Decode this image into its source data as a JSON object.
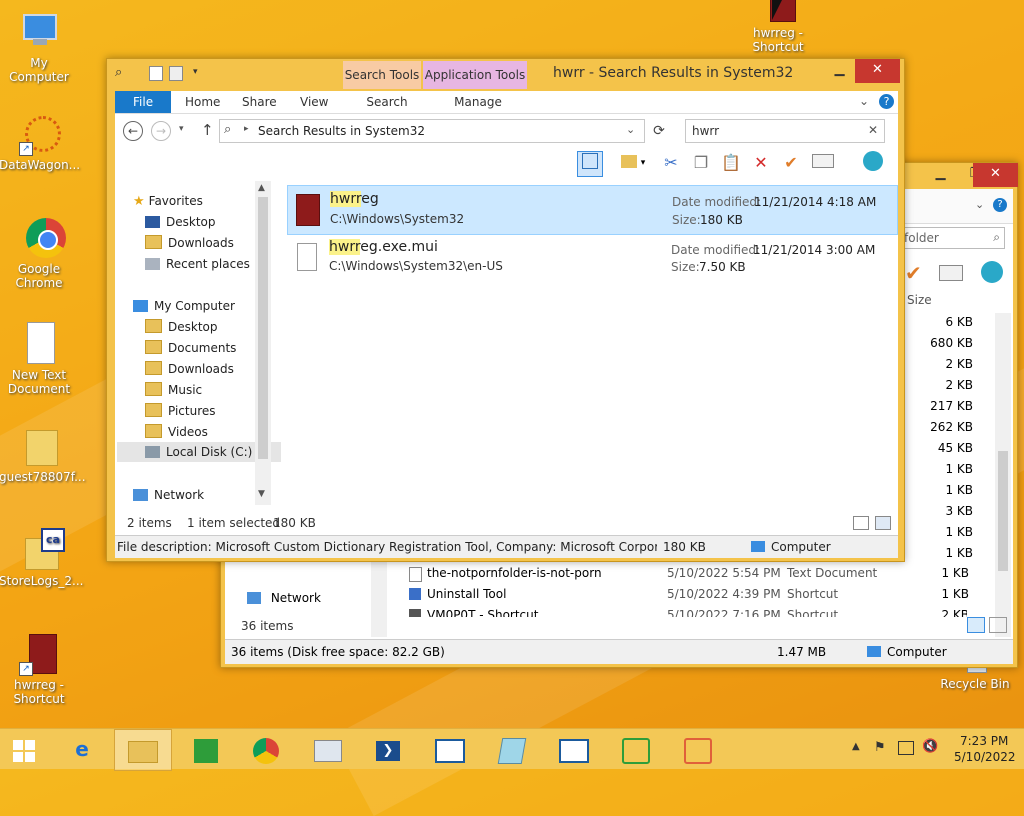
{
  "desktop": {
    "icons": [
      {
        "label": "My Computer"
      },
      {
        "label": "DataWagon..."
      },
      {
        "label": "Google Chrome"
      },
      {
        "label": "New Text Document"
      },
      {
        "label": "guest78807f..."
      },
      {
        "label": "StoreLogs_2..."
      },
      {
        "label": "hwrreg - Shortcut"
      },
      {
        "label": "hwrreg - Shortcut"
      },
      {
        "label": "Recycle Bin"
      }
    ]
  },
  "back_window": {
    "search_placeholder": "folder",
    "size_header": "Size",
    "sizes": [
      "6 KB",
      "680 KB",
      "2 KB",
      "2 KB",
      "217 KB",
      "262 KB",
      "45 KB",
      "1 KB",
      "1 KB",
      "3 KB",
      "1 KB",
      "1 KB"
    ],
    "rows": [
      {
        "name": "the-notpornfolder-is-not-porn",
        "date": "5/10/2022 5:54 PM",
        "type": "Text Document",
        "size": "1 KB"
      },
      {
        "name": "Uninstall Tool",
        "date": "5/10/2022 4:39 PM",
        "type": "Shortcut",
        "size": "1 KB"
      },
      {
        "name": "VM0P0T - Shortcut",
        "date": "5/10/2022 7:16 PM",
        "type": "Shortcut",
        "size": "2 KB"
      }
    ],
    "nav_network": "Network",
    "item_count": "36 items",
    "status_left": "36 items (Disk free space: 82.2 GB)",
    "status_size": "1.47 MB",
    "status_computer": "Computer"
  },
  "main_window": {
    "title": "hwrr - Search Results in System32",
    "context_tabs": {
      "search_tools": "Search Tools",
      "application_tools": "Application Tools"
    },
    "ribbon_tabs": {
      "file": "File",
      "home": "Home",
      "share": "Share",
      "view": "View",
      "search": "Search",
      "manage": "Manage"
    },
    "address": "Search Results in System32",
    "search_value": "hwrr",
    "nav": {
      "favorites": "Favorites",
      "fav_items": [
        "Desktop",
        "Downloads",
        "Recent places"
      ],
      "my_computer": "My Computer",
      "pc_items": [
        "Desktop",
        "Documents",
        "Downloads",
        "Music",
        "Pictures",
        "Videos",
        "Local Disk (C:)"
      ],
      "network": "Network"
    },
    "results": [
      {
        "name_hl": "hwrr",
        "name_rest": "eg",
        "path": "C:\\Windows\\System32",
        "date_label": "Date modified:",
        "date": "11/21/2014 4:18 AM",
        "size_label": "Size:",
        "size": "180 KB"
      },
      {
        "name_hl": "hwrr",
        "name_rest": "eg.exe.mui",
        "path": "C:\\Windows\\System32\\en-US",
        "date_label": "Date modified:",
        "date": "11/21/2014 3:00 AM",
        "size_label": "Size:",
        "size": "7.50 KB"
      }
    ],
    "status": {
      "items": "2 items",
      "selected": "1 item selected",
      "size": "180 KB"
    },
    "details_bar": {
      "description": "File description: Microsoft Custom Dictionary Registration Tool, Company: Microsoft Corporation, File",
      "size": "180 KB",
      "computer": "Computer"
    }
  },
  "taskbar": {
    "time": "7:23 PM",
    "date": "5/10/2022"
  },
  "colors": {
    "accent": "#1979ca",
    "selection": "#cce8ff",
    "highlight": "#fbf28a"
  }
}
